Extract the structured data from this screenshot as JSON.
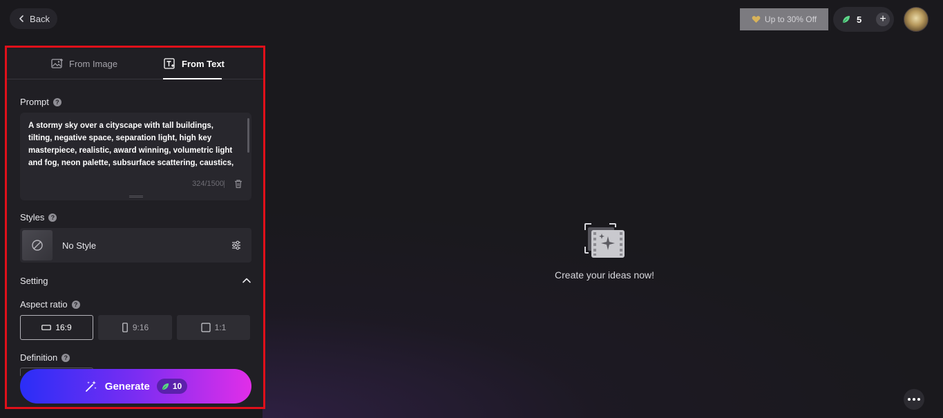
{
  "header": {
    "back_label": "Back",
    "promo_label": "Up to 30% Off",
    "credits": "5"
  },
  "tabs": [
    {
      "label": "From Image",
      "active": false
    },
    {
      "label": "From Text",
      "active": true
    }
  ],
  "prompt": {
    "label": "Prompt",
    "text": "A stormy sky over a cityscape with tall buildings, tilting, negative space, separation light, high key masterpiece, realistic, award winning, volumetric light and fog, neon palette, subsurface scattering, caustics, bloom, perfect",
    "counter": "324/1500"
  },
  "styles": {
    "label": "Styles",
    "selected": "No Style"
  },
  "setting": {
    "label": "Setting",
    "aspect_label": "Aspect ratio",
    "ratios": [
      "16:9",
      "9:16",
      "1:1"
    ],
    "selected_ratio": "16:9",
    "definition_label": "Definition"
  },
  "generate": {
    "label": "Generate",
    "cost": "10"
  },
  "empty_state": {
    "text": "Create your ideas now!"
  },
  "colors": {
    "accent_start": "#2a2ef7",
    "accent_end": "#e12ee8",
    "highlight_border": "#e0101a",
    "leaf_green": "#5fd68a"
  }
}
